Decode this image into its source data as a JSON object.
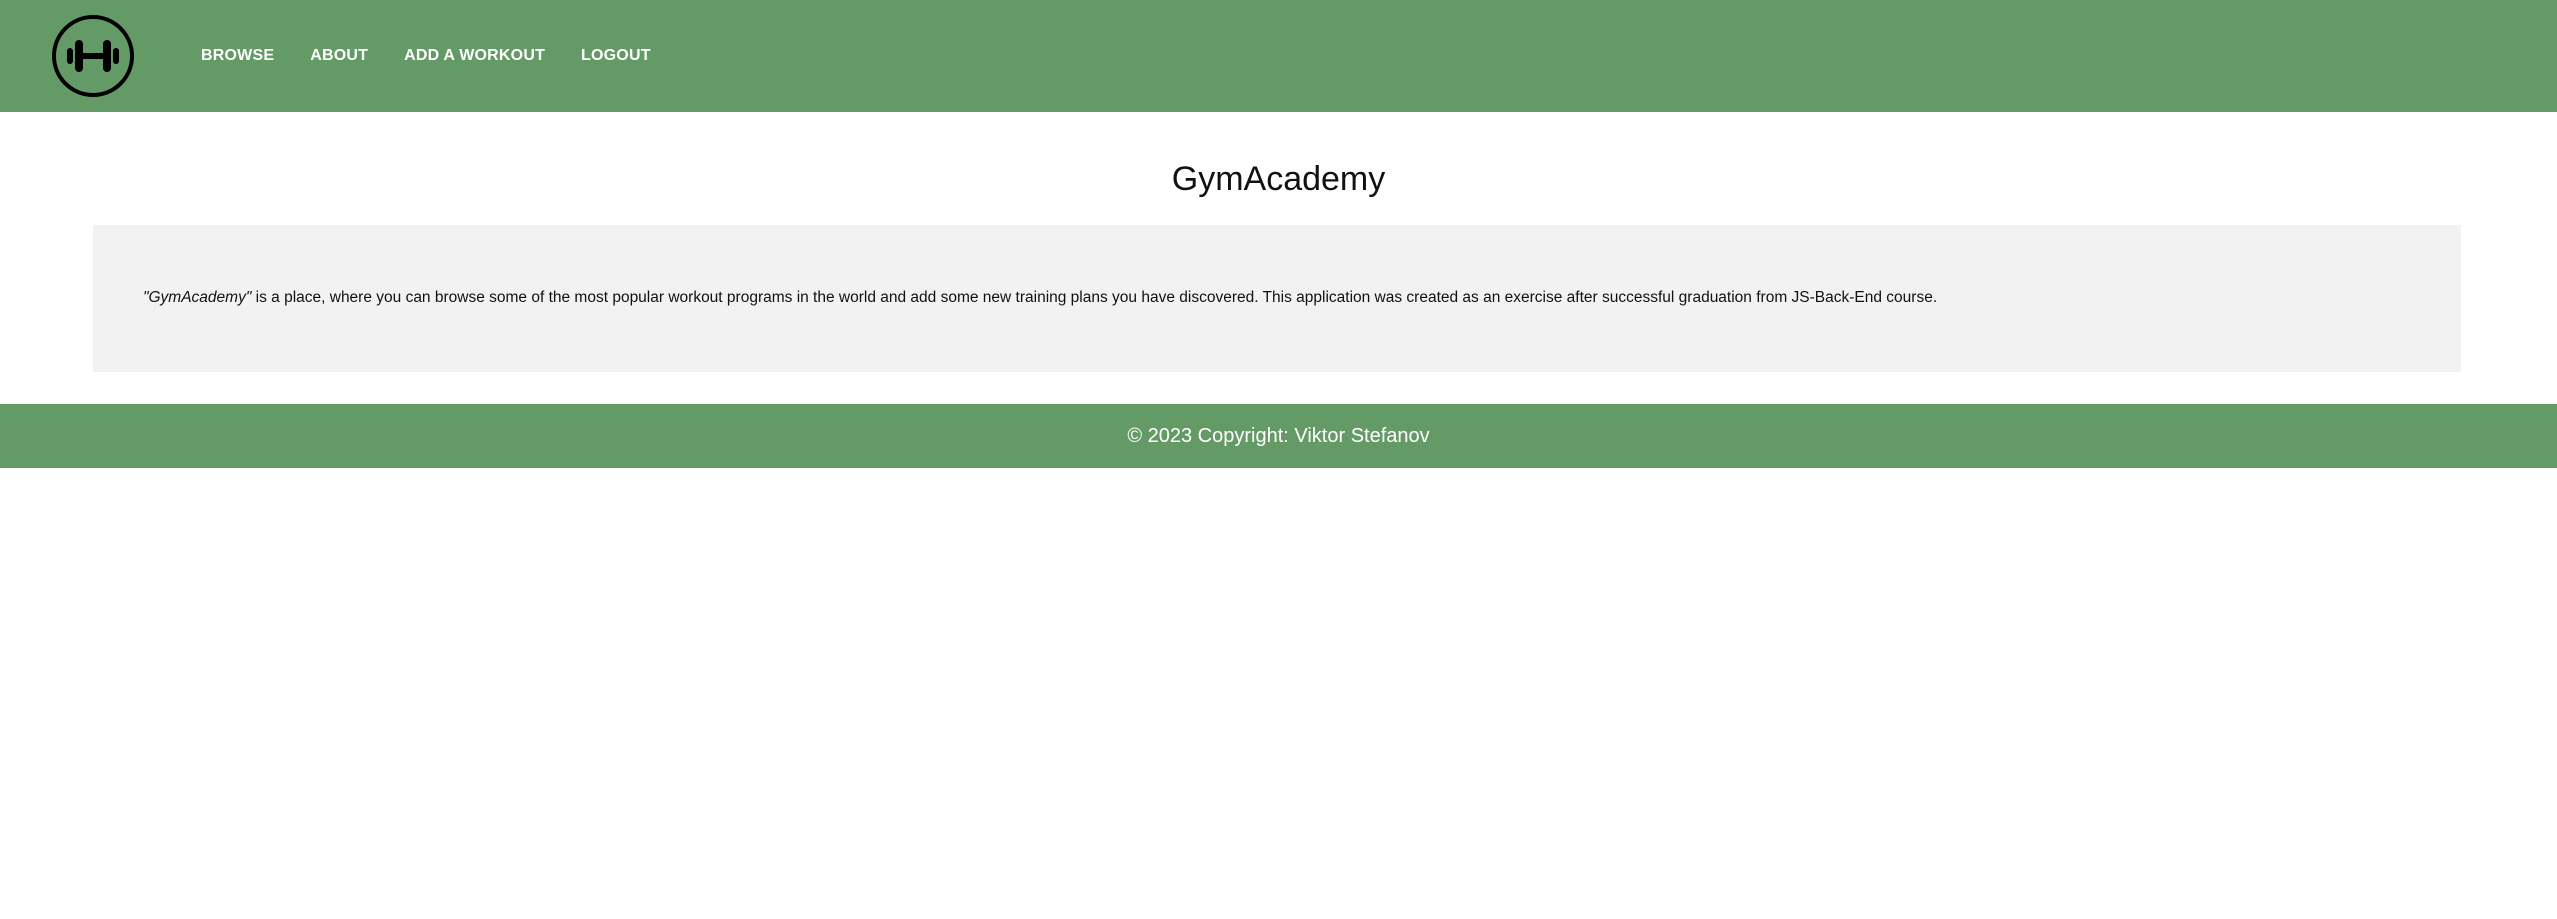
{
  "header": {
    "logo_icon": "dumbbell-icon",
    "nav": [
      {
        "label": "BROWSE"
      },
      {
        "label": "ABOUT"
      },
      {
        "label": "ADD A WORKOUT"
      },
      {
        "label": "LOGOUT"
      }
    ]
  },
  "main": {
    "title": "GymAcademy",
    "description": {
      "app_name_quoted": "\"GymAcademy\"",
      "text": " is a place, where you can browse some of the most popular workout programs in the world and add some new training plans you have discovered. This application was created as an exercise after successful graduation from JS-Back-End course."
    }
  },
  "footer": {
    "copyright": "© 2023 Copyright: Viktor Stefanov"
  },
  "colors": {
    "brand_green": "#649a65",
    "content_bg": "#f2f2f2"
  }
}
